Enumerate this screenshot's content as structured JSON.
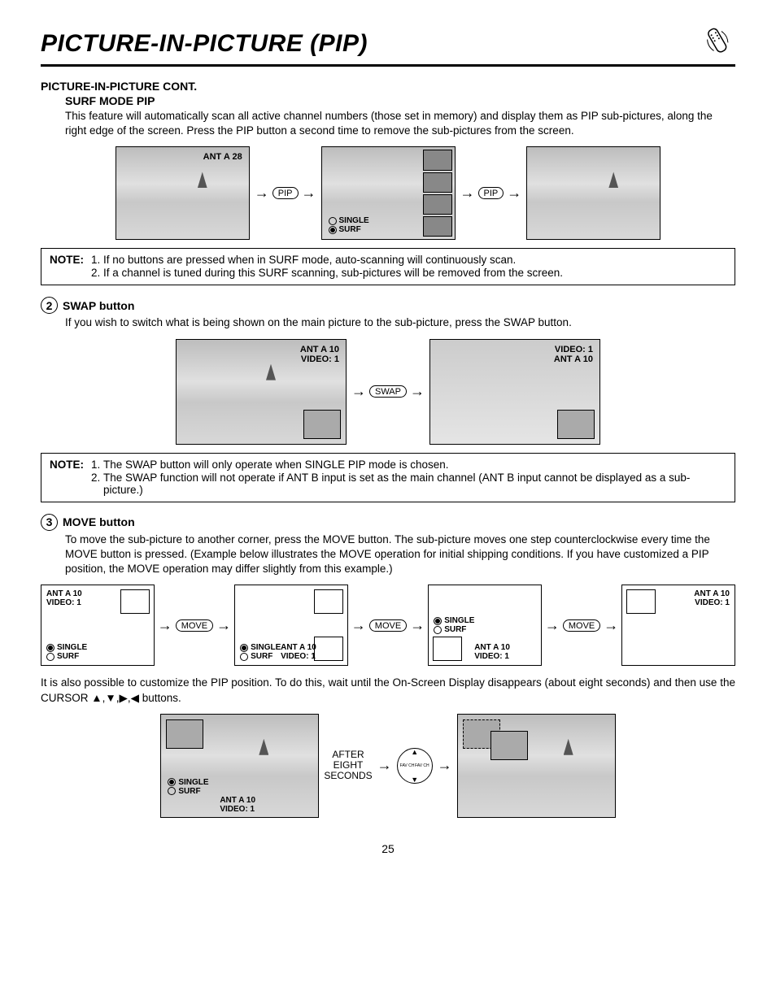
{
  "title": "PICTURE-IN-PICTURE (PIP)",
  "heading_cont": "PICTURE-IN-PICTURE CONT.",
  "surf_mode": {
    "heading": "SURF MODE PIP",
    "body": "This feature will automatically scan all active channel numbers (those set in memory) and display them as PIP sub-pictures, along the right edge of the screen.  Press the PIP button a second time to remove the sub-pictures from the screen.",
    "osd_antA28": "ANT A   28",
    "btn_pip": "PIP",
    "radio_single": "SINGLE",
    "radio_surf": "SURF"
  },
  "note1": {
    "tag": "NOTE:",
    "items": [
      "If no buttons are pressed when in SURF mode, auto-scanning will continuously scan.",
      "If a channel is tuned during this SURF scanning, sub-pictures will be removed from the screen."
    ]
  },
  "swap": {
    "num": "2",
    "heading": "SWAP button",
    "body": "If you wish to switch what is being shown on the main picture to the sub-picture, press the SWAP button.",
    "osd_left_line1": "ANT A 10",
    "osd_left_line2": "VIDEO: 1",
    "osd_right_line1": "VIDEO: 1",
    "osd_right_line2": "ANT  A 10",
    "btn_swap": "SWAP"
  },
  "note2": {
    "tag": "NOTE:",
    "items": [
      "The SWAP button will only operate when SINGLE PIP mode is chosen.",
      "The SWAP function will not operate if ANT B input is set as the main channel (ANT B input cannot be displayed as a sub-picture.)"
    ]
  },
  "move": {
    "num": "3",
    "heading": "MOVE button",
    "body": "To move the sub-picture to another corner, press the MOVE button.  The sub-picture moves one step counterclockwise every time the MOVE button is pressed.  (Example below illustrates the MOVE operation for initial shipping conditions.  If you have customized a PIP position, the MOVE operation may differ slightly from this example.)",
    "btn_move": "MOVE",
    "osd_ant": "ANT A 10",
    "osd_vid": "VIDEO: 1",
    "radio_single": "SINGLE",
    "radio_surf": "SURF"
  },
  "customize_body": "It is also possible to customize the PIP position.  To do this, wait until the On-Screen Display disappears (about eight seconds) and then use the CURSOR ▲,▼,▶,◀ buttons.",
  "after_label_l1": "AFTER",
  "after_label_l2": "EIGHT",
  "after_label_l3": "SECONDS",
  "fav_ch": "FAV CH",
  "page_number": "25"
}
